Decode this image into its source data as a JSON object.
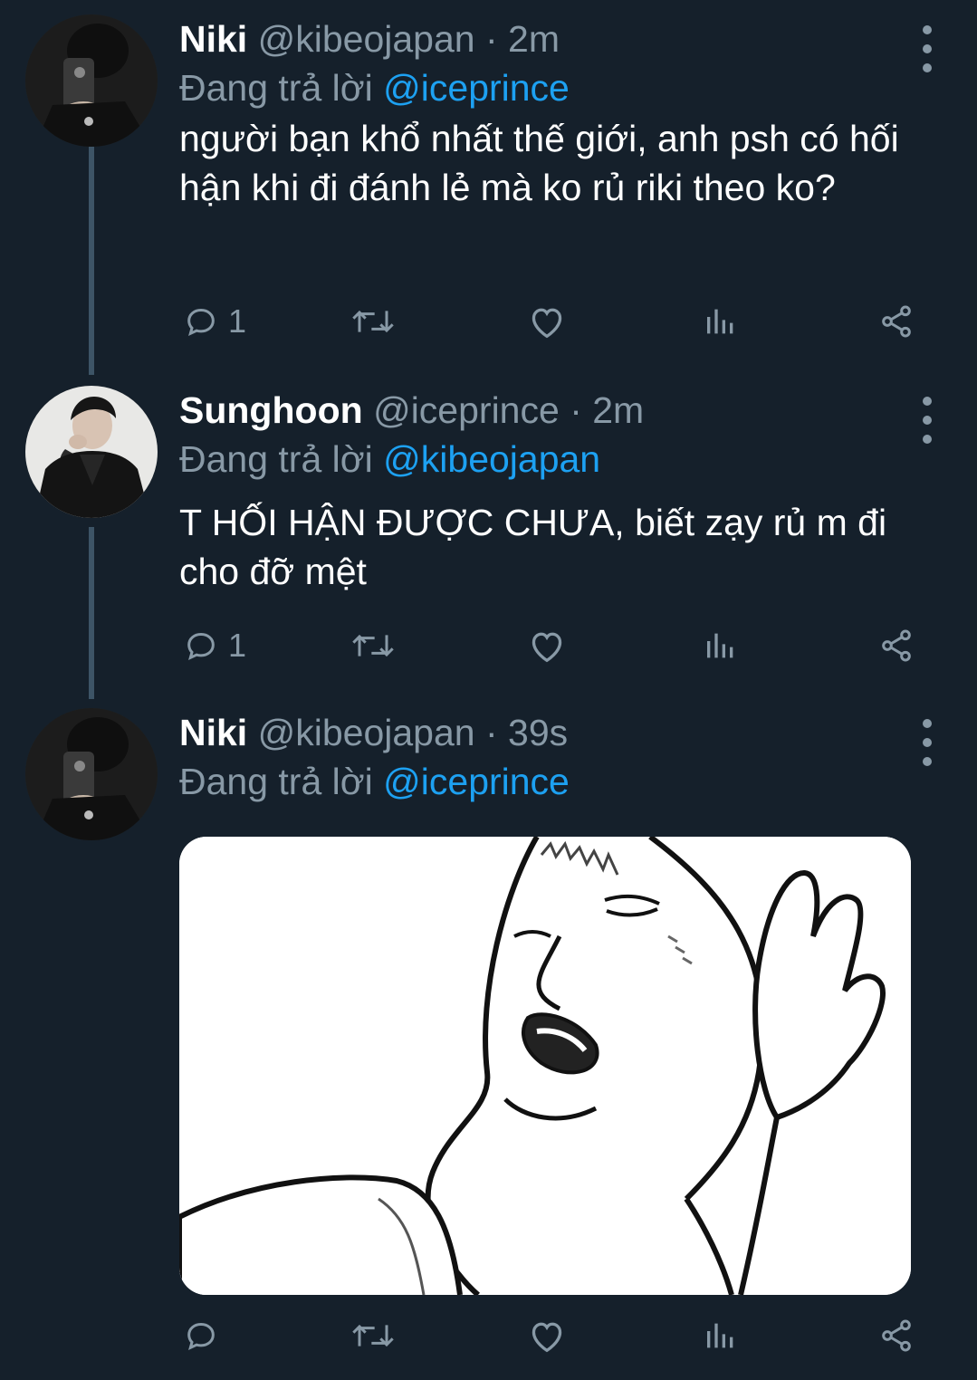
{
  "tweets": [
    {
      "name": "Niki",
      "handle": "@kibeojapan",
      "dot": "·",
      "time": "2m",
      "replying_prefix": "Đang trả lời",
      "replying_to": "@iceprince",
      "text": "người bạn khổ nhất thế giới, anh psh có hối hận khi đi đánh lẻ mà ko rủ riki theo ko?",
      "reply_count": "1",
      "has_media": false
    },
    {
      "name": "Sunghoon",
      "handle": "@iceprince",
      "dot": "·",
      "time": "2m",
      "replying_prefix": "Đang trả lời",
      "replying_to": "@kibeojapan",
      "text": "T HỐI HẬN ĐƯỢC CHƯA, biết zạy rủ m đi cho đỡ mệt",
      "reply_count": "1",
      "has_media": false
    },
    {
      "name": "Niki",
      "handle": "@kibeojapan",
      "dot": "·",
      "time": "39s",
      "replying_prefix": "Đang trả lời",
      "replying_to": "@iceprince",
      "text": "",
      "reply_count": "",
      "has_media": true
    }
  ],
  "icons": {
    "reply": "reply-icon",
    "retweet": "retweet-icon",
    "like": "heart-icon",
    "analytics": "analytics-icon",
    "share": "share-icon",
    "more": "more-vertical-icon"
  },
  "colors": {
    "background": "#15202b",
    "secondary_text": "#8899a6",
    "link": "#1da1f2",
    "thread_line": "#3d5466"
  }
}
